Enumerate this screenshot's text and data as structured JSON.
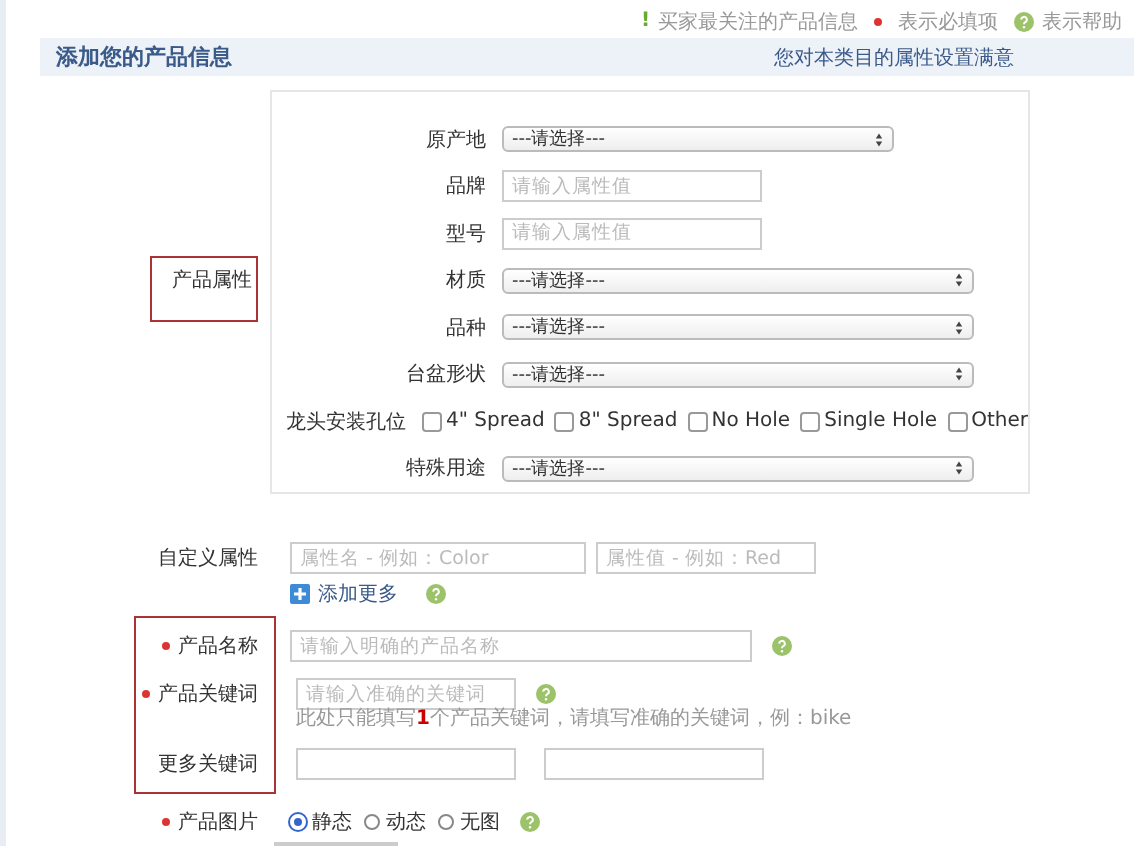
{
  "top_bar": {
    "items": [
      {
        "kind": "note",
        "mark": "!",
        "text": "买家最关注的产品信息"
      },
      {
        "kind": "required",
        "text": "表示必填项"
      },
      {
        "kind": "help",
        "text": "表示帮助"
      }
    ]
  },
  "header": {
    "title": "添加您的产品信息",
    "note": "您对本类目的属性设置满意"
  },
  "product_attributes": {
    "label": "产品属性",
    "fields": [
      {
        "kind": "select",
        "label": "原产地",
        "value": "---请选择---"
      },
      {
        "kind": "text",
        "label": "品牌",
        "placeholder": "请输入属性值"
      },
      {
        "kind": "text",
        "label": "型号",
        "placeholder": "请输入属性值"
      },
      {
        "kind": "select",
        "label": "材质",
        "value": "---请选择---"
      },
      {
        "kind": "select",
        "label": "品种",
        "value": "---请选择---"
      },
      {
        "kind": "select",
        "label": "台盆形状",
        "value": "---请选择---"
      },
      {
        "kind": "checkboxes",
        "label": "龙头安装孔位",
        "options": [
          {
            "label": "4\" Spread",
            "checked": false
          },
          {
            "label": "8\" Spread",
            "checked": false
          },
          {
            "label": "No Hole",
            "checked": false
          },
          {
            "label": "Single Hole",
            "checked": false
          },
          {
            "label": "Other",
            "checked": false
          }
        ]
      },
      {
        "kind": "select",
        "label": "特殊用途",
        "value": "---请选择---"
      }
    ]
  },
  "custom_attribute": {
    "label": "自定义属性",
    "name_placeholder": "属性名 - 例如：Color",
    "value_placeholder": "属性值 - 例如：Red",
    "add_more": "添加更多"
  },
  "product_name": {
    "required": true,
    "label": "产品名称",
    "placeholder": "请输入明确的产品名称"
  },
  "product_keyword": {
    "required": true,
    "label": "产品关键词",
    "placeholder": "请输入准确的关键词",
    "hint": "此处只能填写**1**个产品关键词，请填写准确的关键词，例：bike"
  },
  "more_keywords": {
    "required": false,
    "label": "更多关键词"
  },
  "product_image": {
    "required": true,
    "label": "产品图片",
    "options": [
      {
        "label": "静态",
        "selected": true
      },
      {
        "label": "动态",
        "selected": false
      },
      {
        "label": "无图",
        "selected": false
      }
    ]
  }
}
